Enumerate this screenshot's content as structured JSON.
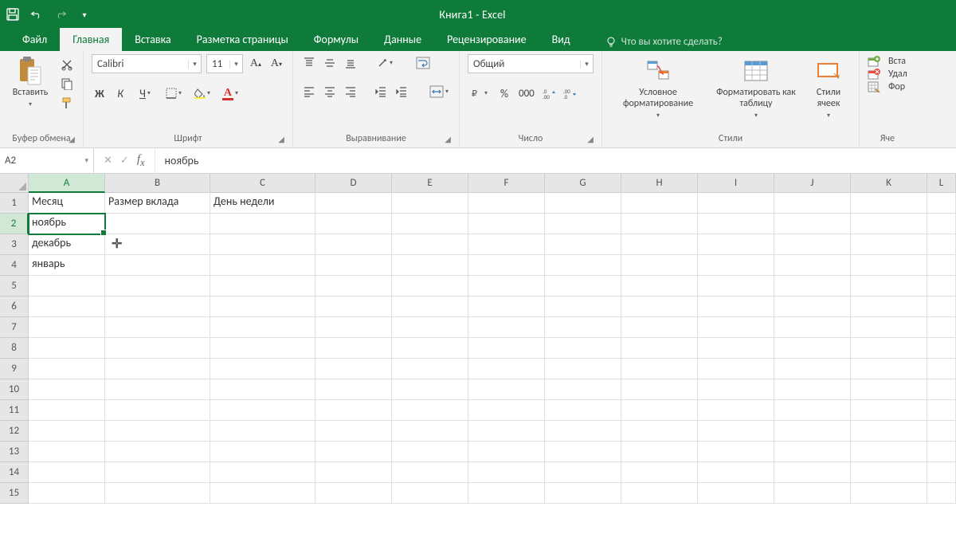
{
  "title": "Книга1 - Excel",
  "tabs": {
    "file": "Файл",
    "home": "Главная",
    "insert": "Вставка",
    "pagelayout": "Разметка страницы",
    "formulas": "Формулы",
    "data": "Данные",
    "review": "Рецензирование",
    "view": "Вид"
  },
  "tellme_placeholder": "Что вы хотите сделать?",
  "ribbon": {
    "clipboard": {
      "paste": "Вставить",
      "group": "Буфер обмена"
    },
    "font": {
      "name": "Calibri",
      "size": "11",
      "group": "Шрифт",
      "bold": "Ж",
      "italic": "К",
      "underline": "Ч"
    },
    "alignment": {
      "group": "Выравнивание"
    },
    "number": {
      "format": "Общий",
      "group": "Число"
    },
    "styles": {
      "condfmt": "Условное форматирование",
      "astable": "Форматировать как таблицу",
      "cellstyles": "Стили ячеек",
      "group": "Стили"
    },
    "cells": {
      "insert": "Вста",
      "delete": "Удал",
      "format": "Фор",
      "group": "Яче"
    }
  },
  "namebox": "A2",
  "formula": "ноябрь",
  "columns": [
    "A",
    "B",
    "C",
    "D",
    "E",
    "F",
    "G",
    "H",
    "I",
    "J",
    "K",
    "L"
  ],
  "rows": [
    "1",
    "2",
    "3",
    "4",
    "5",
    "6",
    "7",
    "8",
    "9",
    "10",
    "11",
    "12",
    "13",
    "14",
    "15"
  ],
  "cells": {
    "A1": "Месяц",
    "B1": "Размер вклада",
    "C1": "День недели",
    "A2": "ноябрь",
    "A3": "декабрь",
    "A4": "январь"
  },
  "selected_cell": "A2"
}
